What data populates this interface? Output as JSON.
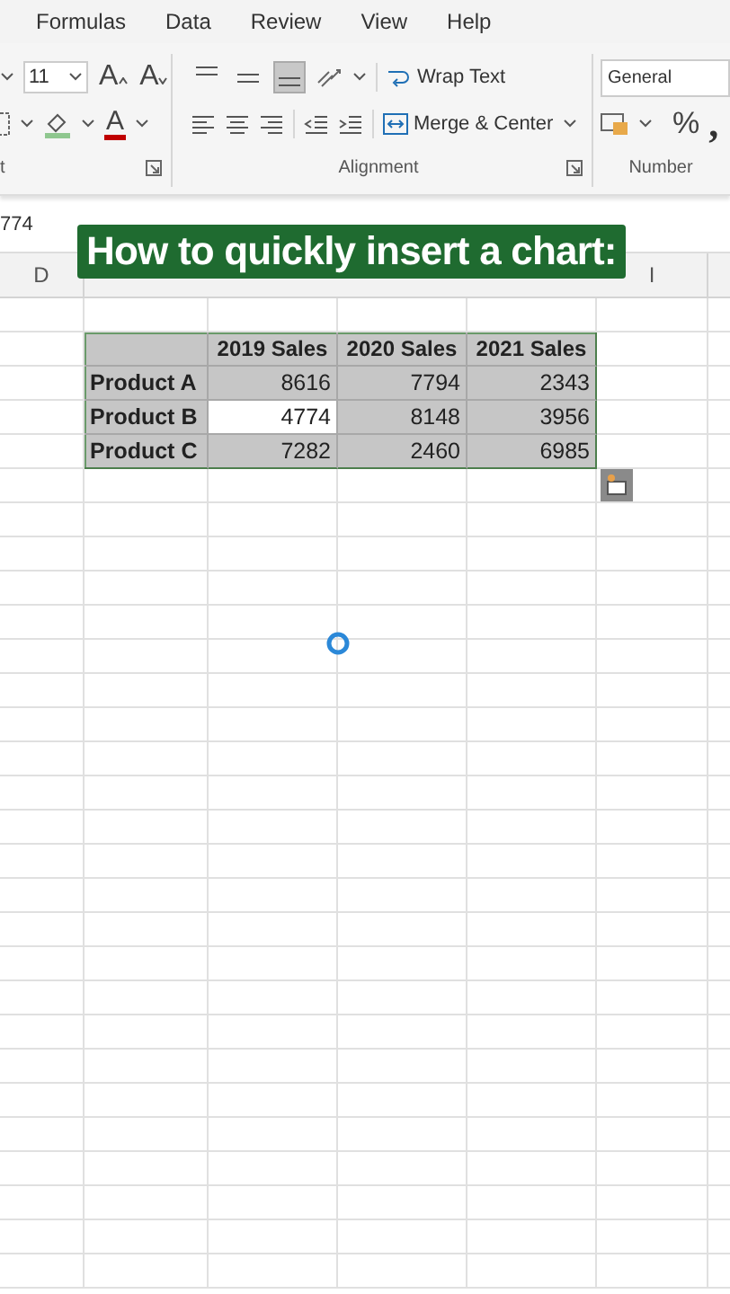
{
  "menu": [
    "Formulas",
    "Data",
    "Review",
    "View",
    "Help"
  ],
  "ribbon": {
    "font_size": "11",
    "grow_font": "A",
    "shrink_font": "A",
    "font_color": "A",
    "font_group_label": "t",
    "vertical_align": [
      {
        "kind": "top",
        "selected": false
      },
      {
        "kind": "middle",
        "selected": false
      },
      {
        "kind": "bottom",
        "selected": true
      }
    ],
    "wrap_text": "Wrap Text",
    "merge": "Merge & Center",
    "alignment_label": "Alignment",
    "number_format": "General",
    "percent": "%",
    "comma": ",",
    "number_label": "Number"
  },
  "formula_bar": {
    "value": "774"
  },
  "column_headers": {
    "left": "D",
    "right": "I"
  },
  "caption": "How to quickly insert a chart:",
  "table": {
    "columns": [
      "2019 Sales",
      "2020 Sales",
      "2021 Sales"
    ],
    "rows": [
      {
        "label": "Product A",
        "values": [
          {
            "text": "8616",
            "selected": false
          },
          {
            "text": "7794",
            "selected": false
          },
          {
            "text": "2343",
            "selected": false
          }
        ]
      },
      {
        "label": "Product B",
        "values": [
          {
            "text": "4774",
            "selected": true
          },
          {
            "text": "8148",
            "selected": false
          },
          {
            "text": "3956",
            "selected": false
          }
        ]
      },
      {
        "label": "Product C",
        "values": [
          {
            "text": "7282",
            "selected": false
          },
          {
            "text": "2460",
            "selected": false
          },
          {
            "text": "6985",
            "selected": false
          }
        ]
      }
    ]
  }
}
